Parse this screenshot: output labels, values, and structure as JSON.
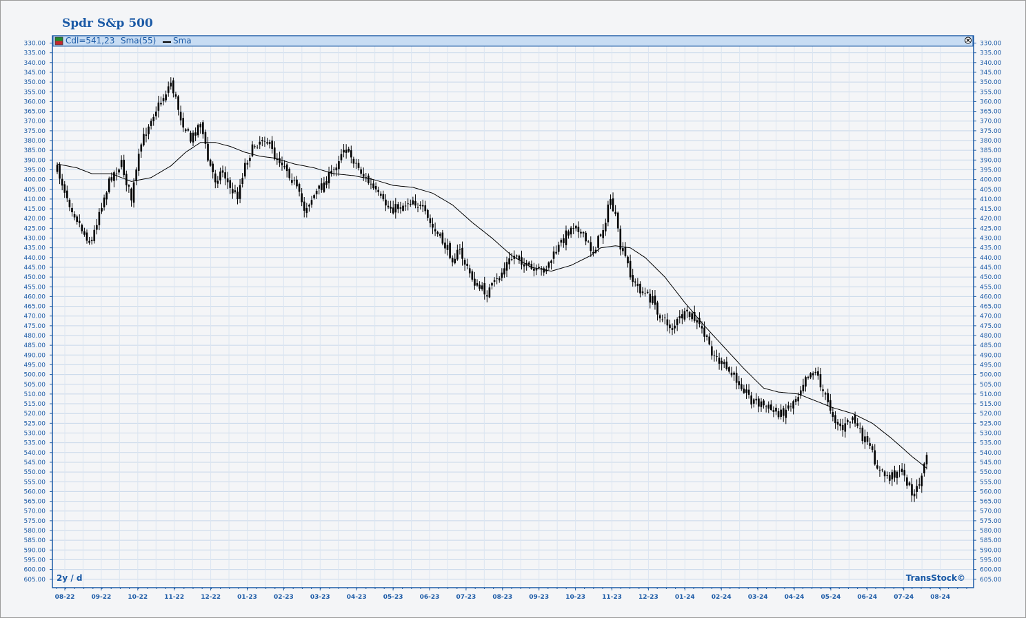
{
  "page": {
    "title": "Spdr S&p 500"
  },
  "legend": {
    "candle_label": "Cdl=541,23",
    "sma_label": "Sma(55)",
    "sma_line_label": "Sma"
  },
  "footer": {
    "period": "2y / d",
    "brand": "TransStock©"
  },
  "colors": {
    "accent": "#1b5aa6",
    "grid": "#c8d8ea",
    "legend_bg": "#c7dcf3",
    "candle": "#000000",
    "sma": "#000000"
  },
  "icons": {
    "close": "close-icon",
    "candle_legend": "candle-legend-icon"
  },
  "chart_data": {
    "type": "candlestick",
    "inverted_y": true,
    "ylim": [
      330,
      605
    ],
    "y_ticks": [
      "330.00",
      "335.00",
      "340.00",
      "345.00",
      "350.00",
      "355.00",
      "360.00",
      "365.00",
      "370.00",
      "375.00",
      "380.00",
      "385.00",
      "390.00",
      "395.00",
      "400.00",
      "405.00",
      "410.00",
      "415.00",
      "420.00",
      "425.00",
      "430.00",
      "435.00",
      "440.00",
      "445.00",
      "450.00",
      "455.00",
      "460.00",
      "465.00",
      "470.00",
      "475.00",
      "480.00",
      "485.00",
      "490.00",
      "495.00",
      "500.00",
      "505.00",
      "510.00",
      "515.00",
      "520.00",
      "525.00",
      "530.00",
      "535.00",
      "540.00",
      "545.00",
      "550.00",
      "555.00",
      "560.00",
      "565.00",
      "570.00",
      "575.00",
      "580.00",
      "585.00",
      "590.00",
      "595.00",
      "600.00",
      "605.00"
    ],
    "x_ticks": [
      "08-22",
      "09-22",
      "10-22",
      "11-22",
      "12-22",
      "01-23",
      "02-23",
      "03-23",
      "04-23",
      "05-23",
      "06-23",
      "07-23",
      "08-23",
      "09-23",
      "10-23",
      "11-23",
      "12-23",
      "01-24",
      "02-24",
      "03-24",
      "04-24",
      "05-24",
      "06-24",
      "07-24",
      "08-24"
    ],
    "price_keypoints": [
      [
        0,
        395
      ],
      [
        5,
        412
      ],
      [
        11,
        428
      ],
      [
        14,
        432
      ],
      [
        17,
        416
      ],
      [
        22,
        398
      ],
      [
        26,
        392
      ],
      [
        30,
        410
      ],
      [
        34,
        382
      ],
      [
        38,
        368
      ],
      [
        42,
        360
      ],
      [
        46,
        350
      ],
      [
        50,
        368
      ],
      [
        54,
        380
      ],
      [
        58,
        370
      ],
      [
        61,
        390
      ],
      [
        64,
        400
      ],
      [
        67,
        395
      ],
      [
        70,
        405
      ],
      [
        73,
        408
      ],
      [
        76,
        392
      ],
      [
        80,
        382
      ],
      [
        84,
        378
      ],
      [
        88,
        388
      ],
      [
        92,
        392
      ],
      [
        96,
        402
      ],
      [
        100,
        415
      ],
      [
        104,
        408
      ],
      [
        108,
        402
      ],
      [
        112,
        395
      ],
      [
        116,
        383
      ],
      [
        120,
        390
      ],
      [
        124,
        398
      ],
      [
        128,
        405
      ],
      [
        132,
        412
      ],
      [
        136,
        415
      ],
      [
        140,
        413
      ],
      [
        144,
        410
      ],
      [
        148,
        416
      ],
      [
        152,
        425
      ],
      [
        156,
        432
      ],
      [
        160,
        440
      ],
      [
        163,
        437
      ],
      [
        166,
        446
      ],
      [
        170,
        455
      ],
      [
        174,
        458
      ],
      [
        178,
        452
      ],
      [
        182,
        443
      ],
      [
        186,
        438
      ],
      [
        190,
        445
      ],
      [
        194,
        448
      ],
      [
        198,
        445
      ],
      [
        202,
        437
      ],
      [
        206,
        428
      ],
      [
        210,
        422
      ],
      [
        213,
        430
      ],
      [
        217,
        437
      ],
      [
        221,
        425
      ],
      [
        224,
        410
      ],
      [
        226,
        420
      ],
      [
        228,
        435
      ],
      [
        230,
        440
      ],
      [
        233,
        452
      ],
      [
        237,
        458
      ],
      [
        241,
        462
      ],
      [
        245,
        472
      ],
      [
        249,
        476
      ],
      [
        253,
        470
      ],
      [
        257,
        470
      ],
      [
        261,
        477
      ],
      [
        265,
        488
      ],
      [
        269,
        495
      ],
      [
        273,
        500
      ],
      [
        277,
        505
      ],
      [
        281,
        513
      ],
      [
        285,
        515
      ],
      [
        289,
        518
      ],
      [
        293,
        520
      ],
      [
        297,
        515
      ],
      [
        300,
        510
      ],
      [
        303,
        500
      ],
      [
        307,
        498
      ],
      [
        311,
        512
      ],
      [
        315,
        523
      ],
      [
        318,
        528
      ],
      [
        322,
        522
      ],
      [
        325,
        530
      ],
      [
        329,
        538
      ],
      [
        333,
        550
      ],
      [
        337,
        553
      ],
      [
        341,
        548
      ],
      [
        344,
        555
      ],
      [
        347,
        562
      ],
      [
        350,
        552
      ],
      [
        352,
        542
      ]
    ],
    "sma_keypoints": [
      [
        0,
        392
      ],
      [
        8,
        394
      ],
      [
        14,
        397
      ],
      [
        22,
        397
      ],
      [
        30,
        401
      ],
      [
        38,
        399
      ],
      [
        46,
        393
      ],
      [
        52,
        386
      ],
      [
        58,
        381
      ],
      [
        64,
        381
      ],
      [
        70,
        383
      ],
      [
        76,
        386
      ],
      [
        82,
        388
      ],
      [
        88,
        389
      ],
      [
        96,
        392
      ],
      [
        104,
        394
      ],
      [
        112,
        397
      ],
      [
        120,
        398
      ],
      [
        128,
        400
      ],
      [
        136,
        403
      ],
      [
        144,
        404
      ],
      [
        152,
        407
      ],
      [
        160,
        413
      ],
      [
        168,
        422
      ],
      [
        176,
        430
      ],
      [
        184,
        439
      ],
      [
        192,
        445
      ],
      [
        200,
        447
      ],
      [
        208,
        444
      ],
      [
        216,
        439
      ],
      [
        220,
        435
      ],
      [
        226,
        434
      ],
      [
        232,
        435
      ],
      [
        238,
        440
      ],
      [
        246,
        450
      ],
      [
        254,
        463
      ],
      [
        262,
        475
      ],
      [
        270,
        486
      ],
      [
        278,
        497
      ],
      [
        286,
        507
      ],
      [
        292,
        509
      ],
      [
        300,
        510
      ],
      [
        306,
        513
      ],
      [
        314,
        517
      ],
      [
        322,
        520
      ],
      [
        330,
        525
      ],
      [
        338,
        533
      ],
      [
        346,
        542
      ],
      [
        352,
        548
      ]
    ],
    "last_close": 541.23,
    "sessions": 353
  }
}
